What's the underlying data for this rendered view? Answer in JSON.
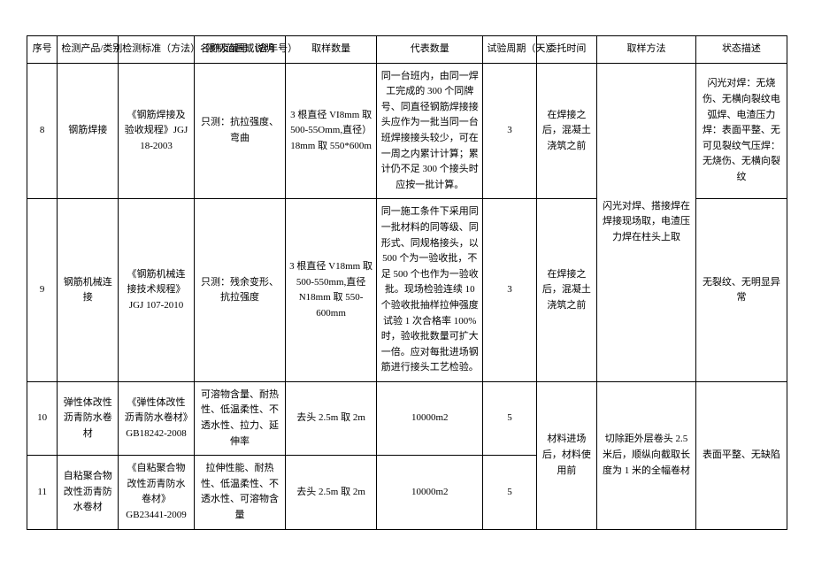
{
  "headers": {
    "seq": "序号",
    "product": "检测产品/类别",
    "standard": "检测标准（方法）名称及编号（含年号）",
    "limit": "限制范围或说明",
    "sample_qty": "取样数量",
    "represent": "代表数量",
    "period": "试验周期（天）",
    "trust": "委托时间",
    "method": "取样方法",
    "status": "状态描述"
  },
  "rows": {
    "r8": {
      "seq": "8",
      "product": "钢筋焊接",
      "standard": "《钢筋焊接及验收规程》JGJ 18-2003",
      "limit": "只测：抗拉强度、弯曲",
      "sample_qty": "3 根直径 VI8mm 取 500-55Omm,直径）18mm 取 550*600m",
      "represent": "同一台班内，由同一焊工完成的 300 个同牌号、同直径钢筋焊接接头应作为一批当同一台班焊接接头较少，可在一周之内累计计算；累计仍不足 300 个接头时应按一批计算。",
      "period": "3",
      "trust": "在焊接之后，混凝土浇筑之前",
      "status": "闪光对焊：无烧伤、无横向裂纹电弧焊、电渣压力焊：表面平整、无可见裂纹气压焊：无烧伤、无横向裂纹"
    },
    "r9": {
      "seq": "9",
      "product": "钢筋机械连接",
      "standard": "《钢筋机械连接技术规程》JGJ 107-2010",
      "limit": "只测：残余变形、抗拉强度",
      "sample_qty": "3 根直径 V18mm 取 500-550mm,直径 N18mm 取 550-600mm",
      "represent": "同一施工条件下采用同一批材料的同等级、同形式、同规格接头，以 500 个为一验收批，不足 500 个也作为一验收批。现场检验连续 10 个验收批抽样拉伸强度试验 1 次合格率 100%时，验收批数量可扩大一倍。应对每批进场钢筋进行接头工艺检验。",
      "period": "3",
      "trust": "在焊接之后，混凝土浇筑之前",
      "status": "无裂纹、无明显异常"
    },
    "method_8_9": "闪光对焊、搭接焊在焊接现场取，电渣压力焊在柱头上取",
    "r10": {
      "seq": "10",
      "product": "弹性体改性沥青防水卷材",
      "standard": "《弹性体改性沥青防水卷材》GB18242-2008",
      "limit": "可溶物含量、耐热性、低温柔性、不透水性、拉力、延伸率",
      "sample_qty": "去头 2.5m 取 2m",
      "represent": "10000m2",
      "period": "5"
    },
    "r11": {
      "seq": "11",
      "product": "自粘聚合物改性沥青防水卷材",
      "standard": "《自粘聚合物改性沥青防水卷材》GB23441-2009",
      "limit": "拉伸性能、耐热性、低温柔性、不透水性、可溶物含量",
      "sample_qty": "去头 2.5m 取 2m",
      "represent": "10000m2",
      "period": "5"
    },
    "trust_10_11": "材料进场后，材料使用前",
    "method_10_11": "切除距外层卷头 2.5 米后，顺纵向截取长度为 1 米的全幅卷材",
    "status_10_11": "表面平整、无缺陷"
  }
}
